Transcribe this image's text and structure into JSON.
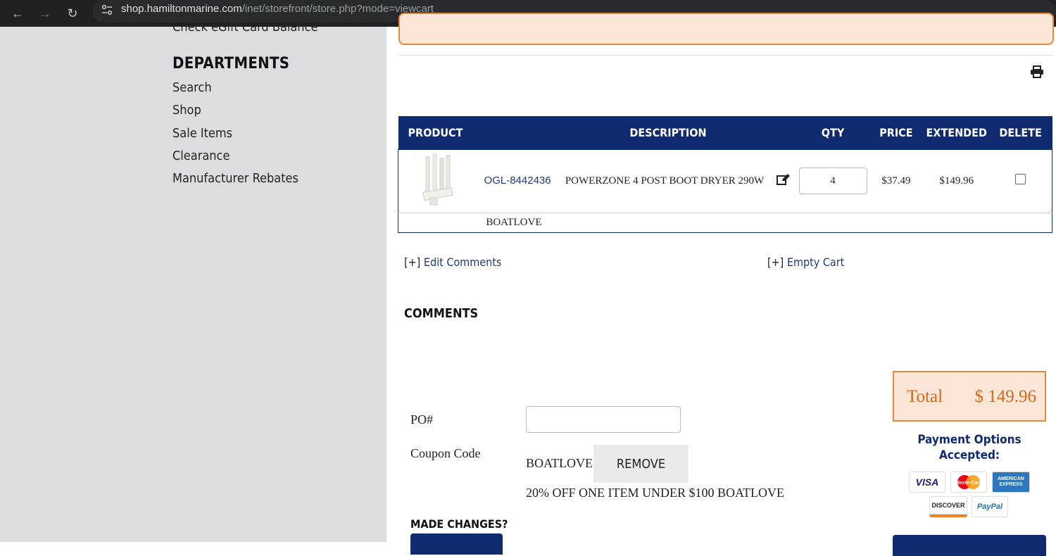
{
  "browser": {
    "url_host": "shop.hamiltonmarine.com",
    "url_path": "/inet/storefront/store.php?mode=viewcart"
  },
  "sidebar": {
    "partial_link": "Check eGift Card Balance",
    "heading": "DEPARTMENTS",
    "items": [
      "Search",
      "Shop",
      "Sale Items",
      "Clearance",
      "Manufacturer Rebates"
    ]
  },
  "cart": {
    "columns": [
      "PRODUCT",
      "DESCRIPTION",
      "QTY",
      "PRICE",
      "EXTENDED",
      "DELETE"
    ],
    "item": {
      "sku": "OGL-8442436",
      "description": "POWERZONE 4 POST BOOT DRYER 290W",
      "qty": "4",
      "price": "$37.49",
      "extended": "$149.96"
    },
    "coupon_line": "BOATLOVE"
  },
  "links": {
    "edit_comments_prefix": "[+]",
    "edit_comments": "Edit Comments",
    "empty_cart_prefix": "[+]",
    "empty_cart": "Empty Cart"
  },
  "comments_heading": "COMMENTS",
  "form": {
    "po_label": "PO#",
    "coupon_label": "Coupon Code",
    "coupon_value": "BOATLOVE",
    "remove_label": "REMOVE",
    "coupon_description": "20% OFF ONE ITEM UNDER $100 BOATLOVE",
    "made_changes": "MADE CHANGES?"
  },
  "summary": {
    "total_label": "Total",
    "total_value": "$ 149.96",
    "payment_heading": "Payment Options Accepted:",
    "cards": [
      "VISA",
      "MasterCard",
      "AMERICAN EXPRESS",
      "DISCOVER",
      "PayPal"
    ]
  },
  "colors": {
    "navy": "#0f2a6e",
    "orange": "#e48a3e",
    "peach": "#fbe6d8",
    "sidebar_bg": "#dcdde0"
  }
}
